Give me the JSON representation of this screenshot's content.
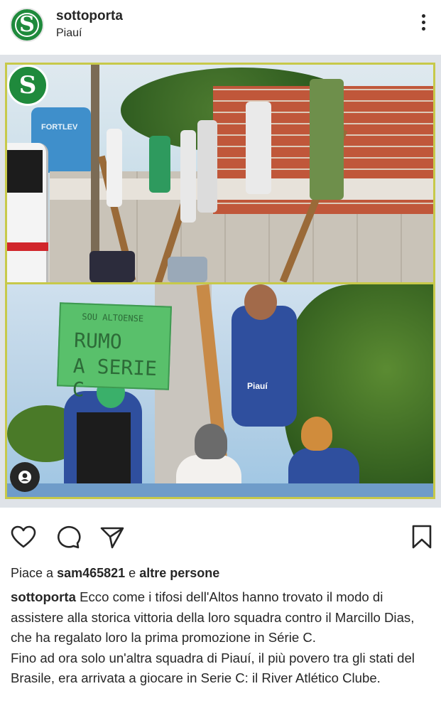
{
  "post": {
    "username": "sottoporta",
    "location": "Piauí",
    "avatar_glyph": "S",
    "photo_logo_glyph": "S"
  },
  "photo": {
    "watertower_text": "FORTLEV",
    "sign_line1": "SOU ALTOENSE",
    "sign_line2": "RUMO",
    "sign_line3": "A SERIE C",
    "shirt_text": "Piauí",
    "colors": {
      "frame": "#c7c94a",
      "brand_green": "#1f8a3c",
      "sign_green": "#59c06b",
      "shirt_blue": "#2f4f9e"
    }
  },
  "icons": {
    "like": "heart-icon",
    "comment": "comment-icon",
    "share": "send-icon",
    "save": "bookmark-icon",
    "more": "more-vertical-icon",
    "tagged": "user-tag-icon"
  },
  "likes": {
    "prefix": "Piace a",
    "user": "sam465821",
    "connector": "e",
    "others": "altre persone"
  },
  "caption": {
    "user": "sottoporta",
    "paragraph1": "Ecco come i tifosi dell'Altos hanno trovato il modo di assistere alla storica vittoria della loro squadra contro il Marcillo Dias, che ha regalato loro la prima promozione in Série C.",
    "paragraph2": "Fino ad ora solo un'altra squadra di Piauí, il più povero tra gli stati del Brasile, era arrivata a giocare in Serie C: il River Atlético Clube."
  }
}
